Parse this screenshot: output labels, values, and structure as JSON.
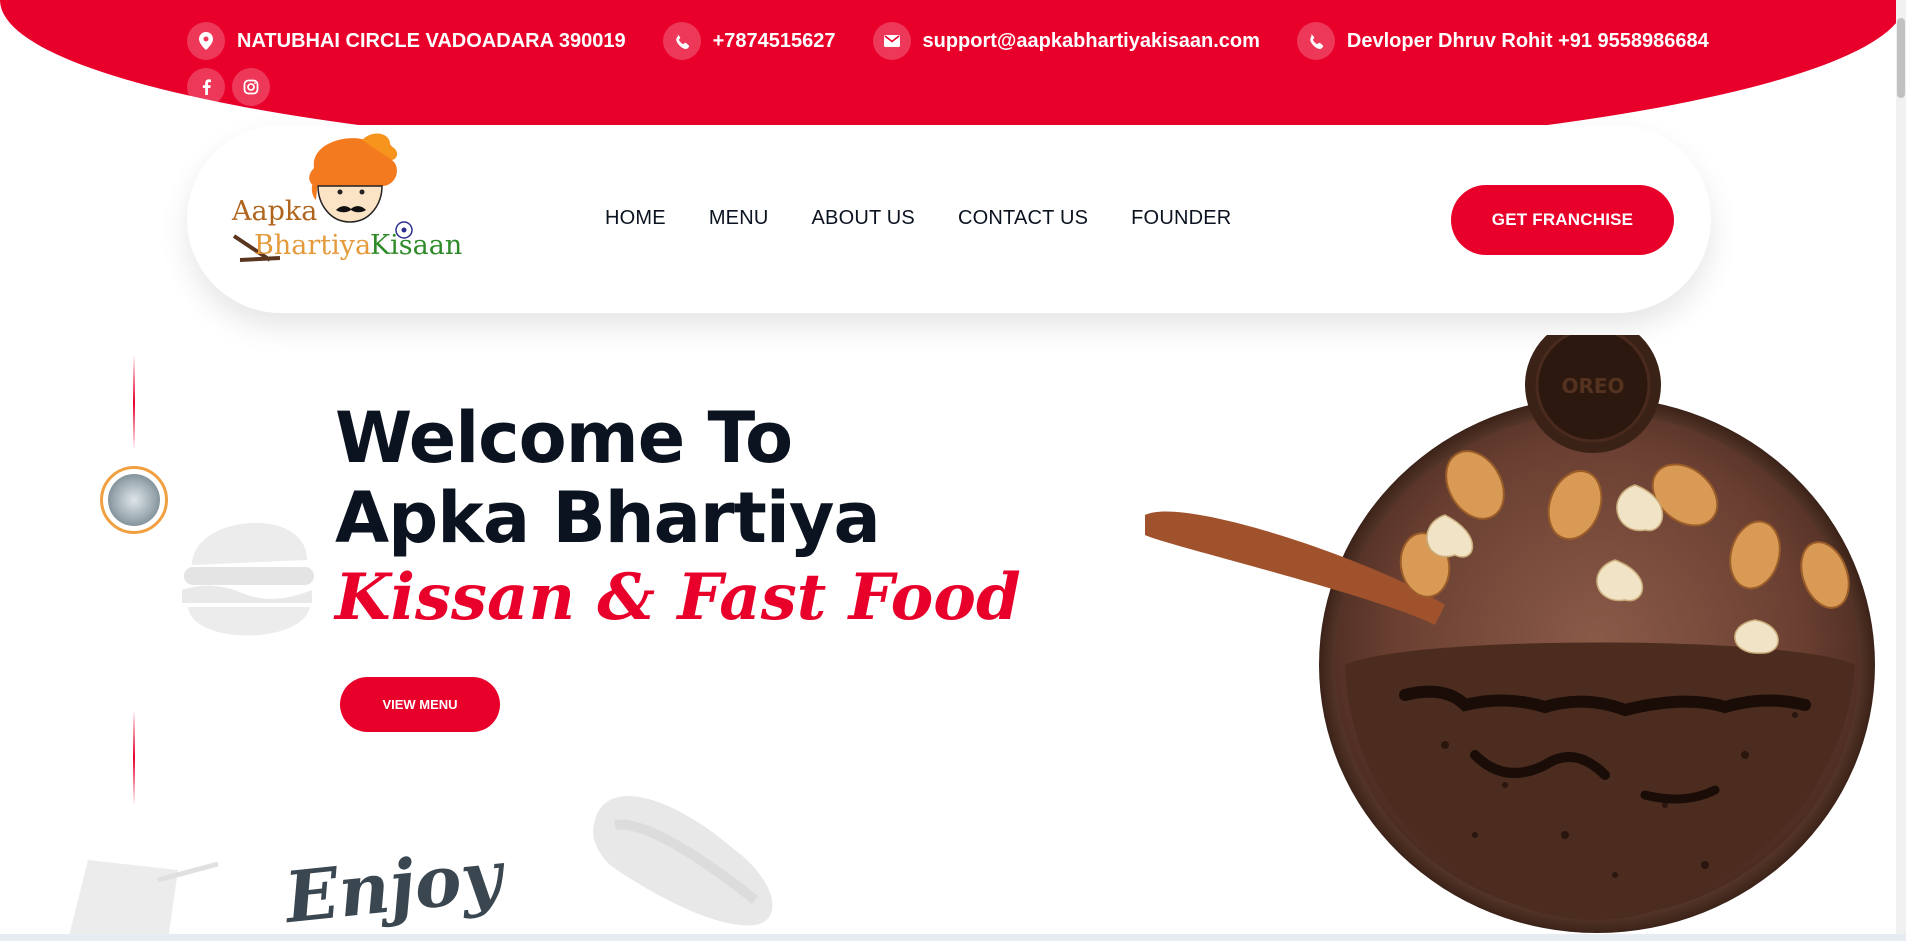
{
  "contact_bar": {
    "items": [
      {
        "icon": "location-pin-icon",
        "text": "NATUBHAI CIRCLE VADOADARA 390019"
      },
      {
        "icon": "phone-icon",
        "text": "+7874515627"
      },
      {
        "icon": "mail-icon",
        "text": "support@aapkabhartiyakisaan.com"
      },
      {
        "icon": "phone-icon",
        "text": "Devloper Dhruv Rohit +91 9558986684"
      }
    ],
    "social": [
      "facebook-icon",
      "instagram-icon"
    ]
  },
  "logo": {
    "line1": "Aapka",
    "line2a": "Bhartiya",
    "line2b": "Kisaan"
  },
  "nav": {
    "items": [
      "HOME",
      "MENU",
      "ABOUT US",
      "CONTACT US",
      "FOUNDER"
    ],
    "cta": "GET FRANCHISE"
  },
  "hero": {
    "title_line1": "Welcome To",
    "title_line2": "Apka Bhartiya",
    "title_line3": "Kissan & Fast Food",
    "button": "VIEW MENU",
    "enjoy": "Enjoy"
  },
  "colors": {
    "brand_red": "#e8002b",
    "dark_text": "#0b1320",
    "accent_orange": "#f0a040"
  }
}
